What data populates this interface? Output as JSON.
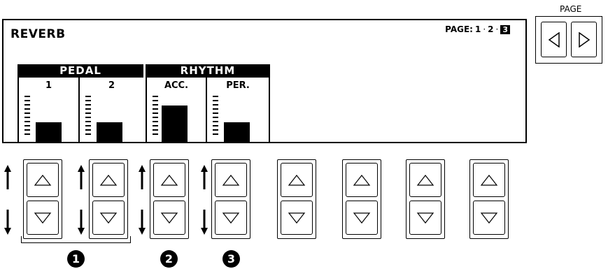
{
  "lcd": {
    "title": "REVERB",
    "page": {
      "prefix": "PAGE:",
      "p1": "1",
      "p2": "2",
      "current": "3",
      "sep": "·"
    },
    "groups": [
      {
        "label": "PEDAL",
        "columns": [
          {
            "label": "1",
            "level": 0.45
          },
          {
            "label": "2",
            "level": 0.45
          }
        ]
      },
      {
        "label": "RHYTHM",
        "columns": [
          {
            "label": "ACC.",
            "level": 0.82
          },
          {
            "label": "PER.",
            "level": 0.45
          }
        ]
      }
    ]
  },
  "page_buttons": {
    "label": "PAGE",
    "left_icon": "triangle-left-icon",
    "right_icon": "triangle-right-icon"
  },
  "callouts": [
    "1",
    "2",
    "3"
  ]
}
